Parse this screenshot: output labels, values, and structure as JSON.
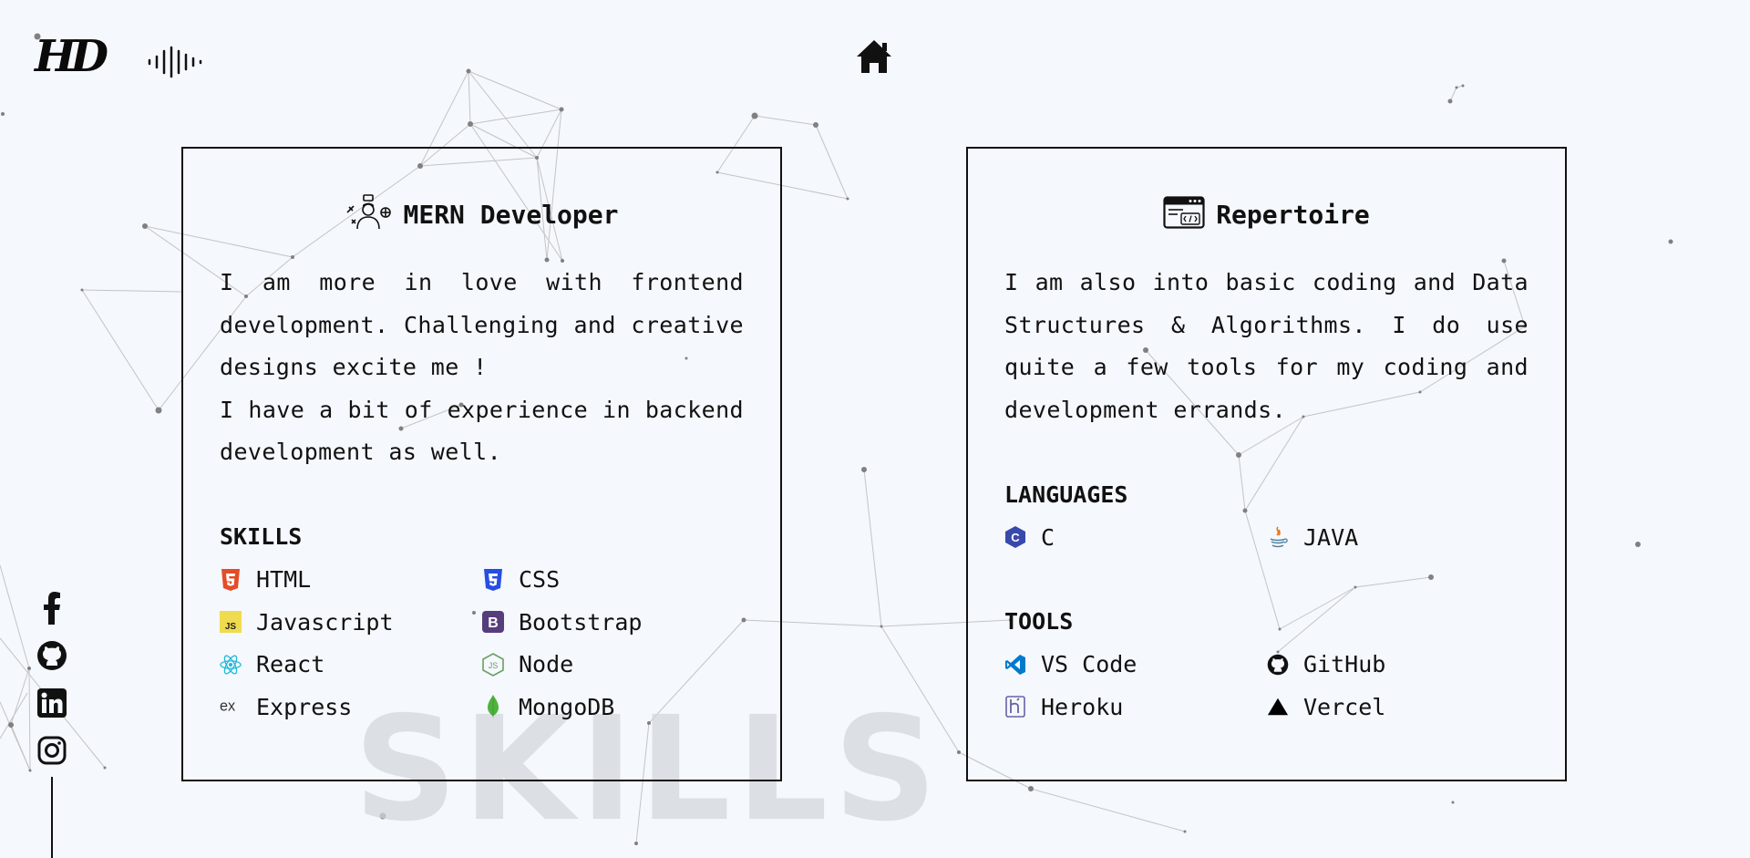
{
  "header": {
    "logo_text": "HD",
    "icons": {
      "sound": "sound-wave-icon",
      "home": "home-icon"
    }
  },
  "watermark": "SKILLS",
  "mern_card": {
    "title": "MERN Developer",
    "title_icon": "developer-avatar-icon",
    "description": [
      "I am more in love with frontend development. Challenging and creative designs excite me !",
      "I have a bit of experience in backend development as well."
    ],
    "skills_heading": "SKILLS",
    "skills": [
      {
        "label": "HTML",
        "icon": "html5-icon",
        "color": "#e44d26"
      },
      {
        "label": "CSS",
        "icon": "css3-icon",
        "color": "#264de4"
      },
      {
        "label": "Javascript",
        "icon": "javascript-icon",
        "color": "#f0db4f"
      },
      {
        "label": "Bootstrap",
        "icon": "bootstrap-icon",
        "color": "#563d7c"
      },
      {
        "label": "React",
        "icon": "react-icon",
        "color": "#61dafb"
      },
      {
        "label": "Node",
        "icon": "nodejs-icon",
        "color": "#68a063"
      },
      {
        "label": "Express",
        "icon": "express-icon",
        "color": "#333333"
      },
      {
        "label": "MongoDB",
        "icon": "mongodb-icon",
        "color": "#4db33d"
      }
    ]
  },
  "repertoire_card": {
    "title": "Repertoire",
    "title_icon": "code-window-icon",
    "description": "I am also into basic coding and Data Structures & Algorithms. I do use quite a few tools for my coding and development errands.",
    "languages_heading": "LANGUAGES",
    "languages": [
      {
        "label": "C",
        "icon": "c-language-icon",
        "color": "#3949ab"
      },
      {
        "label": "JAVA",
        "icon": "java-icon",
        "color": "#e76f00"
      }
    ],
    "tools_heading": "TOOLS",
    "tools": [
      {
        "label": "VS Code",
        "icon": "vscode-icon",
        "color": "#007acc"
      },
      {
        "label": "GitHub",
        "icon": "github-icon",
        "color": "#111111"
      },
      {
        "label": "Heroku",
        "icon": "heroku-icon",
        "color": "#6762a6"
      },
      {
        "label": "Vercel",
        "icon": "vercel-icon",
        "color": "#000000"
      }
    ]
  },
  "socials": [
    "facebook-icon",
    "github-icon",
    "linkedin-icon",
    "instagram-icon"
  ]
}
